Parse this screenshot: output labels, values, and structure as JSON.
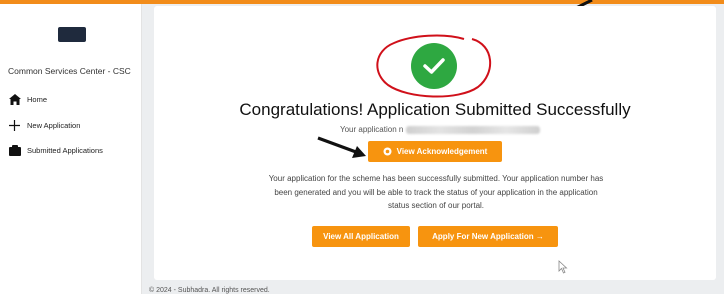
{
  "app": {
    "brand_name": "Common Services Center - CSC"
  },
  "sidebar": {
    "items": [
      {
        "label": "Home",
        "icon": "home-icon"
      },
      {
        "label": "New Application",
        "icon": "plus-icon"
      },
      {
        "label": "Submitted Applications",
        "icon": "folder-icon"
      }
    ]
  },
  "main": {
    "status_icon": "check-circle-icon",
    "headline": "Congratulations! Application Submitted Successfully",
    "app_number_prefix": "Your application n",
    "view_ack_label": "View Acknowledgement",
    "message": "Your application for the scheme has been successfully submitted. Your application number has been generated and you will be able to track the status of your application in the application status section of our portal.",
    "view_all_label": "View All Application",
    "apply_new_label": "Apply For New Application →"
  },
  "footer": {
    "text": "© 2024 - Subhadra. All rights reserved."
  },
  "colors": {
    "accent": "#f7940f",
    "success": "#2ea841",
    "top_bar": "#f28c1a",
    "annotation": "#d0101a"
  }
}
